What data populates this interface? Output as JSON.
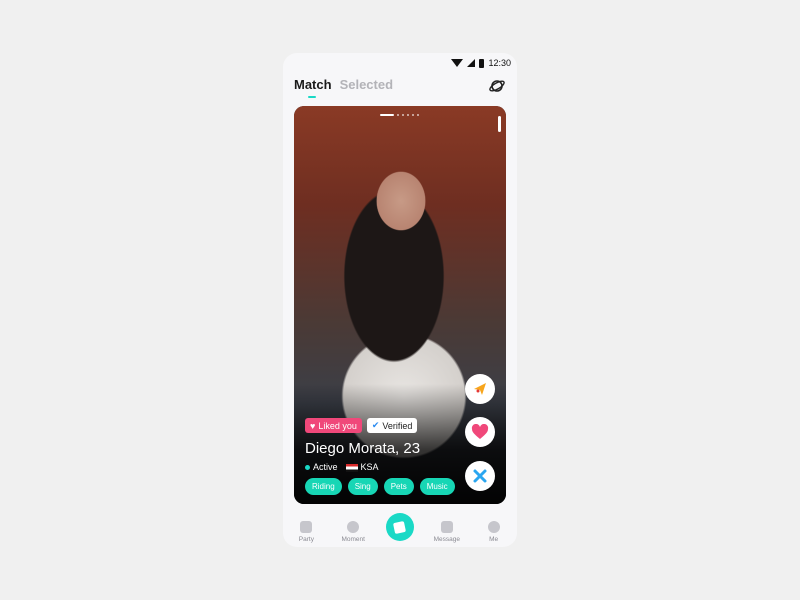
{
  "status": {
    "time": "12:30"
  },
  "header": {
    "tabs": [
      {
        "label": "Match",
        "active": true
      },
      {
        "label": "Selected",
        "active": false
      }
    ],
    "action_icon": "planet-icon"
  },
  "card": {
    "badges": {
      "liked": "Liked you",
      "verified": "Verified"
    },
    "name": "Diego Morata, 23",
    "status": "Active",
    "country": "KSA",
    "tags": [
      "Riding",
      "Sing",
      "Pets",
      "Music"
    ],
    "photo_count": 6,
    "current_photo": 1
  },
  "actions": [
    "boost-icon",
    "heart-icon",
    "close-icon"
  ],
  "nav": {
    "items": [
      {
        "label": "Party"
      },
      {
        "label": "Moment"
      },
      {
        "label": ""
      },
      {
        "label": "Message"
      },
      {
        "label": "Me"
      }
    ]
  },
  "colors": {
    "accent": "#1ad9c6",
    "liked": "#f0487a",
    "tag": "#17d6b5"
  }
}
